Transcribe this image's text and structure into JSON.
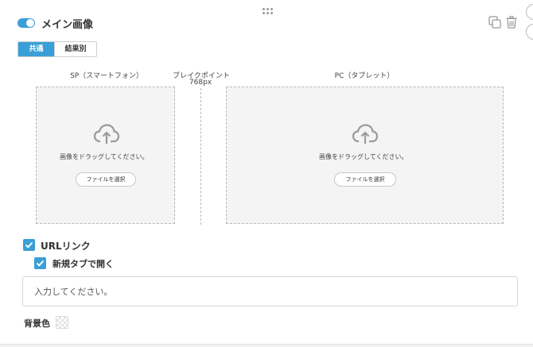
{
  "header": {
    "toggle_on": true,
    "title": "メイン画像",
    "icons": [
      "toggle-switch",
      "drag-handle-icon",
      "copy-icon",
      "trash-icon"
    ]
  },
  "tabs": [
    {
      "label": "共通",
      "active": true
    },
    {
      "label": "結果別",
      "active": false
    }
  ],
  "breakpoint": {
    "label": "ブレイクポイント",
    "value": "768px"
  },
  "dropzones": {
    "sp": {
      "label": "SP（スマートフォン）",
      "hint": "画像をドラッグしてください。",
      "button": "ファイルを選択"
    },
    "pc": {
      "label": "PC（タブレット）",
      "hint": "画像をドラッグしてください。",
      "button": "ファイルを選択"
    }
  },
  "url_link": {
    "checkbox_label": "URLリンク",
    "checked": true,
    "new_tab_label": "新規タブで開く",
    "new_tab_checked": true,
    "input_placeholder": "入力してください。",
    "input_value": ""
  },
  "background": {
    "label": "背景色"
  },
  "colors": {
    "accent": "#3a9fd6",
    "dropzone_bg": "#f4f4f4"
  }
}
